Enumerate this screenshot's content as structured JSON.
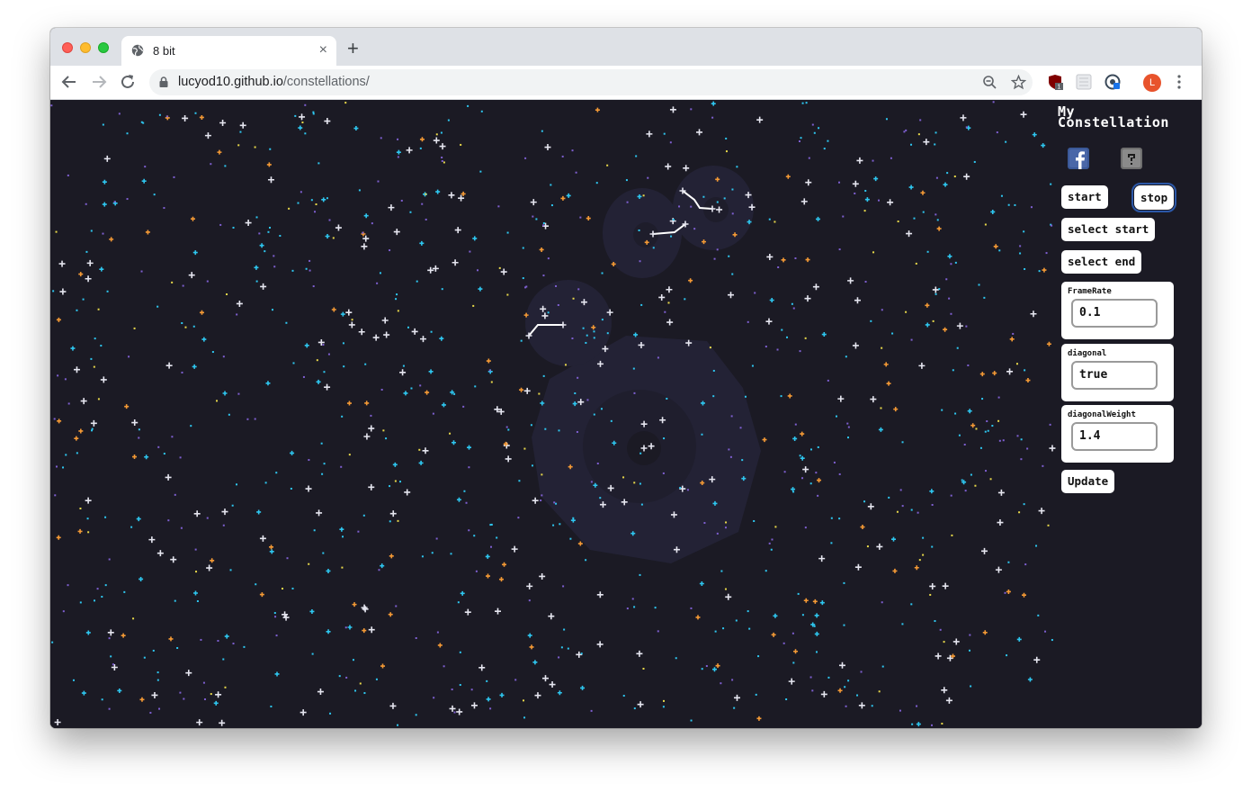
{
  "browser": {
    "tab_title": "8 bit",
    "new_tab_label": "+",
    "tab_close_label": "×",
    "url_host": "lucyod10.github.io",
    "url_path": "/constellations/",
    "extension_badge": "1",
    "profile_initial": "L"
  },
  "sidebar": {
    "logo_line1": "My",
    "logo_line2": "Constellation",
    "facebook_icon": "facebook-icon",
    "help_icon": "help-icon",
    "start_label": "start",
    "stop_label": "stop",
    "select_start_label": "select start",
    "select_end_label": "select end",
    "fields": [
      {
        "label": "FrameRate",
        "value": "0.1"
      },
      {
        "label": "diagonal",
        "value": "true"
      },
      {
        "label": "diagonalWeight",
        "value": "1.4"
      }
    ],
    "update_label": "Update"
  },
  "colors": {
    "sky": "#1b1a24",
    "star_white": "#e6e6f0",
    "star_cyan": "#2ec7f0",
    "star_orange": "#f59a35",
    "star_purple": "#7e5fd0",
    "star_yellow": "#e8d84a",
    "nebula": "#25243a",
    "accent_outline": "#2c58a8"
  }
}
